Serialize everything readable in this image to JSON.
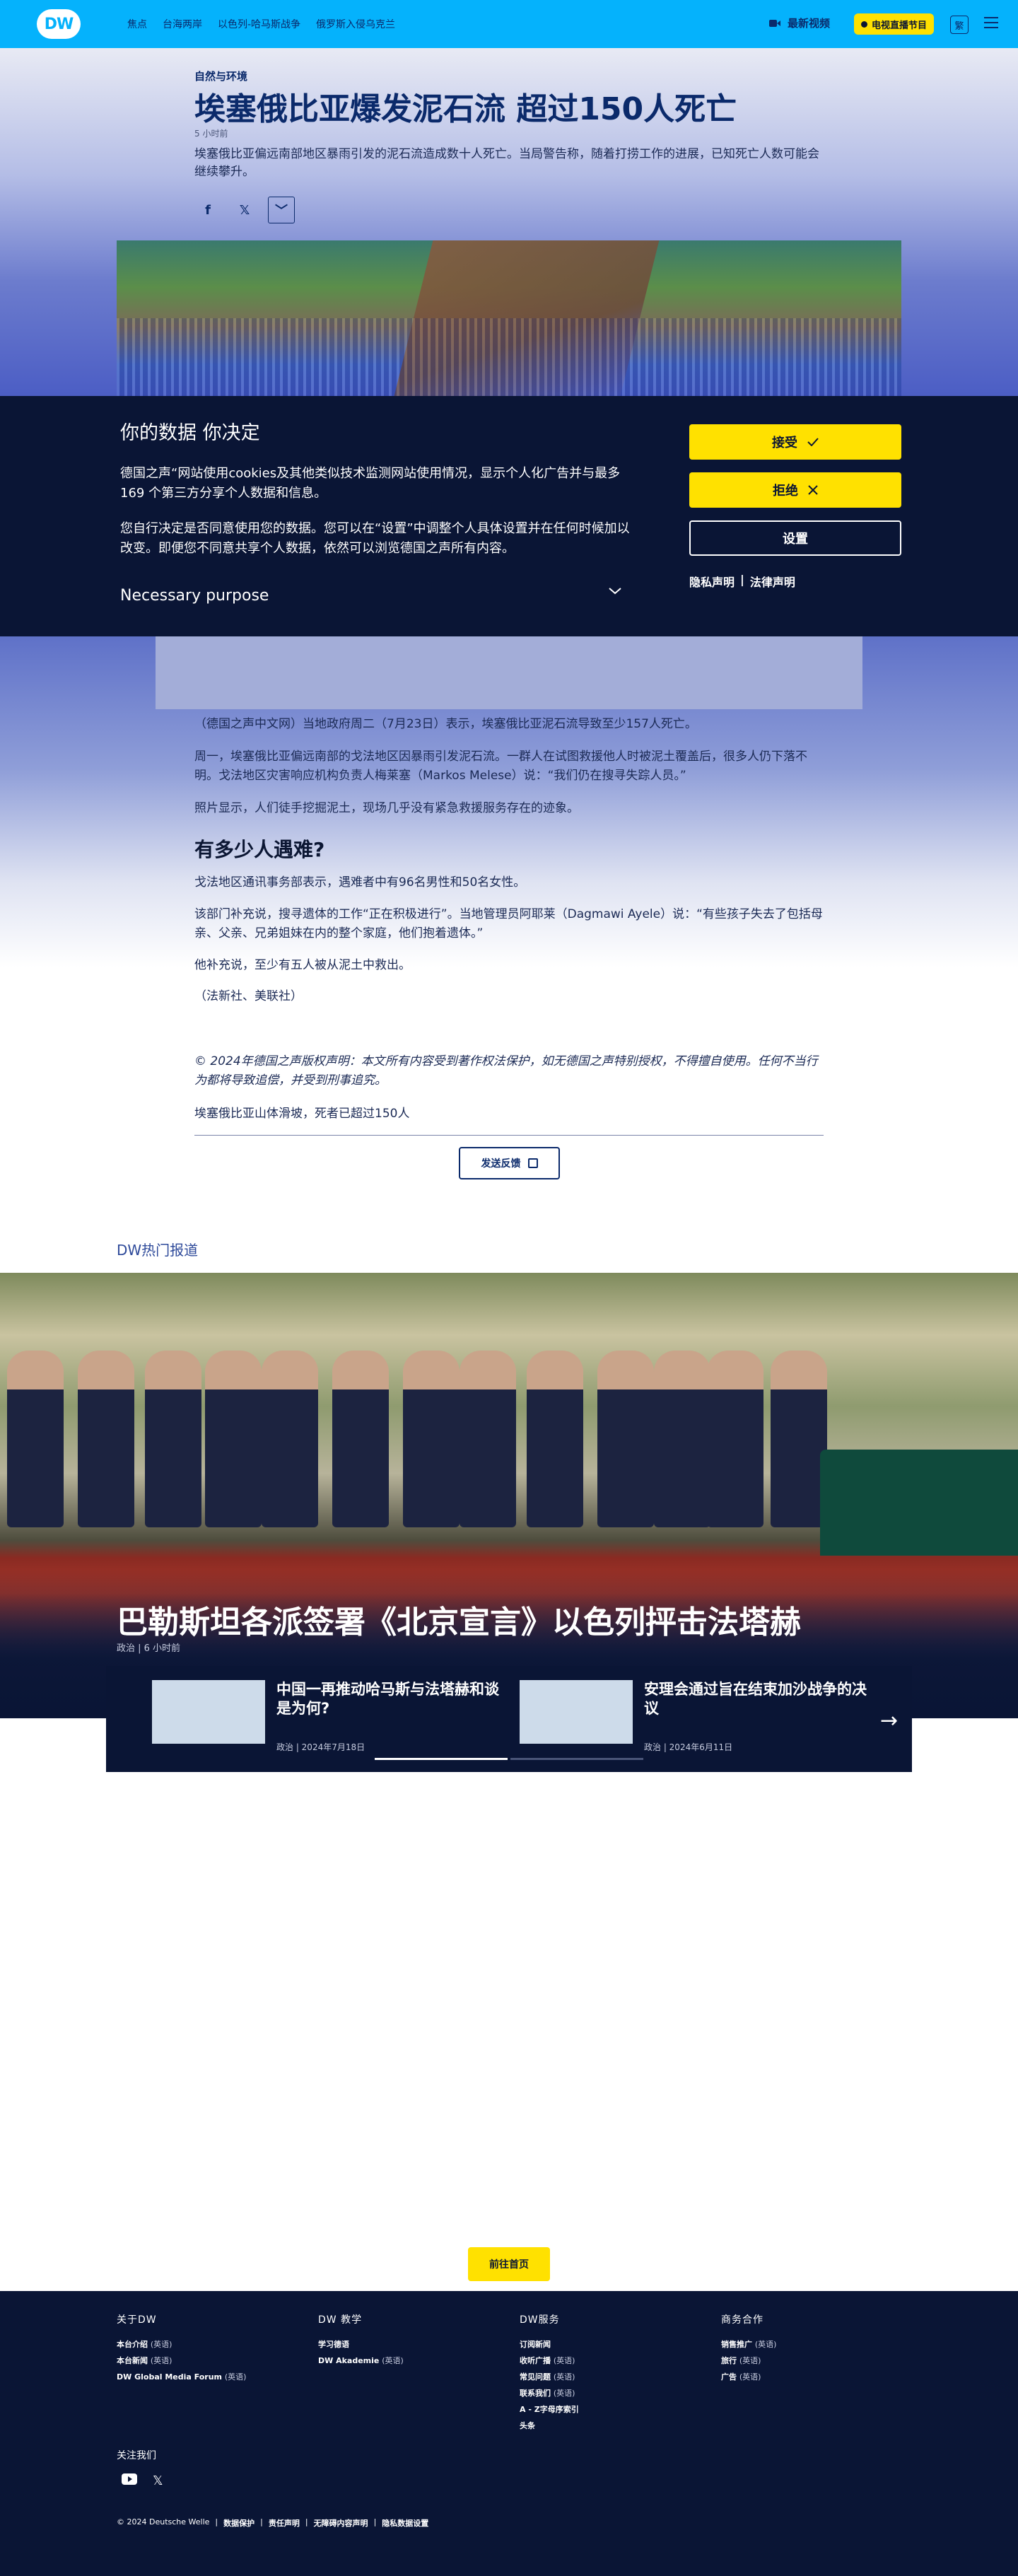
{
  "header": {
    "logo": "DW",
    "nav": [
      "焦点",
      "台海两岸",
      "以色列-哈马斯战争",
      "俄罗斯入侵乌克兰"
    ],
    "video_label": "最新视频",
    "live_label": "电视直播节目",
    "lang_label": "繁"
  },
  "article": {
    "kicker": "自然与环境",
    "headline": "埃塞俄比亚爆发泥石流 超过150人死亡",
    "timestamp": "5 小时前",
    "teaser": "埃塞俄比亚偏远南部地区暴雨引发的泥石流造成数十人死亡。当局警告称，随着打捞工作的进展，已知死亡人数可能会继续攀升。",
    "share": {
      "facebook": "f",
      "x": "𝕏",
      "more": "﹀"
    },
    "paragraphs": [
      "（德国之声中文网）当地政府周二（7月23日）表示，埃塞俄比亚泥石流导致至少157人死亡。",
      "周一，埃塞俄比亚偏远南部的戈法地区因暴雨引发泥石流。一群人在试图救援他人时被泥土覆盖后，很多人仍下落不明。戈法地区灾害响应机构负责人梅莱塞（Markos Melese）说：“我们仍在搜寻失踪人员。”",
      "照片显示，人们徒手挖掘泥土，现场几乎没有紧急救援服务存在的迹象。"
    ],
    "subhead": "有多少人遇难?",
    "paragraphs2": [
      "戈法地区通讯事务部表示，遇难者中有96名男性和50名女性。",
      "该部门补充说，搜寻遗体的工作“正在积极进行”。当地管理员阿耶莱（Dagmawi Ayele）说：“有些孩子失去了包括母亲、父亲、兄弟姐妹在内的整个家庭，他们抱着遗体。”",
      "他补充说，至少有五人被从泥土中救出。",
      "（法新社、美联社）"
    ],
    "copyright": "© 2024年德国之声版权声明：本文所有内容受到著作权法保护，如无德国之声特别授权，不得擅自使用。任何不当行为都将导致追偿，并受到刑事追究。",
    "related_link": "埃塞俄比亚山体滑坡，死者已超过150人",
    "feedback_label": "发送反馈"
  },
  "consent": {
    "title": "你的数据 你决定",
    "p1": "德国之声“网站使用cookies及其他类似技术监测网站使用情况，显示个人化广告并与最多169 个第三方分享个人数据和信息。",
    "p2": "您自行决定是否同意使用您的数据。您可以在“设置”中调整个人具体设置并在任何时候加以改变。即便您不同意共享个人数据，依然可以浏览德国之声所有内容。",
    "purpose_label": "Necessary purpose",
    "accept_label": "接受",
    "reject_label": "拒绝",
    "settings_label": "设置",
    "privacy_label": "隐私声明",
    "legal_label": "法律声明"
  },
  "top_stories": {
    "label": "DW热门报道",
    "headline": "巴勒斯坦各派签署《北京宣言》以色列抨击法塔赫",
    "meta": "政治 | 6 小时前",
    "cards": [
      {
        "title": "中国一再推动哈马斯与法塔赫和谈是为何?",
        "meta": "政治 | 2024年7月18日"
      },
      {
        "title": "安理会通过旨在结束加沙战争的决议",
        "meta": "政治 | 2024年6月11日"
      }
    ],
    "home_label": "前往首页"
  },
  "footer": {
    "columns": [
      {
        "head": "关于DW",
        "items": [
          {
            "label": "本台介绍",
            "lang": "(英语)"
          },
          {
            "label": "本台新闻",
            "lang": "(英语)"
          },
          {
            "label": "DW Global Media Forum",
            "lang": "(英语)"
          }
        ]
      },
      {
        "head": "DW 教学",
        "items": [
          {
            "label": "学习德语",
            "lang": ""
          },
          {
            "label": "DW Akademie",
            "lang": "(英语)"
          }
        ]
      },
      {
        "head": "DW服务",
        "items": [
          {
            "label": "订阅新闻",
            "lang": ""
          },
          {
            "label": "收听广播",
            "lang": "(英语)"
          },
          {
            "label": "常见问题",
            "lang": "(英语)"
          },
          {
            "label": "联系我们",
            "lang": "(英语)"
          },
          {
            "label": "A - Z字母序索引",
            "lang": ""
          },
          {
            "label": "头条",
            "lang": ""
          }
        ]
      },
      {
        "head": "商务合作",
        "items": [
          {
            "label": "销售推广",
            "lang": "(英语)"
          },
          {
            "label": "旅行",
            "lang": "(英语)"
          },
          {
            "label": "广告",
            "lang": "(英语)"
          }
        ]
      }
    ],
    "follow_label": "关注我们",
    "copyright": "© 2024 Deutsche Welle",
    "links": [
      "数据保护",
      "责任声明",
      "无障碍内容声明",
      "隐私数据设置"
    ]
  }
}
